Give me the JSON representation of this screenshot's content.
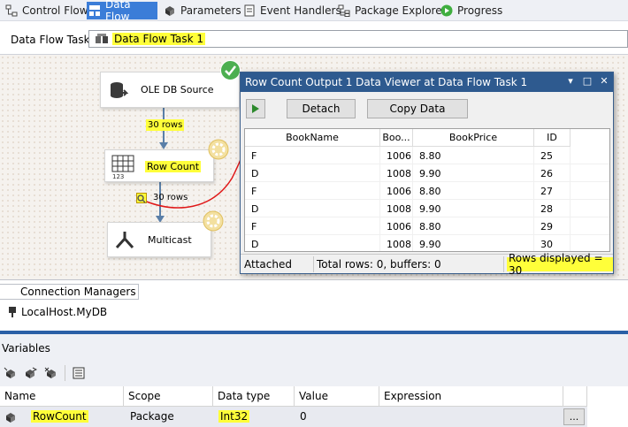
{
  "tabs": [
    {
      "label": "Control Flow",
      "icon": "control-flow-icon",
      "active": false
    },
    {
      "label": "Data Flow",
      "icon": "data-flow-icon",
      "active": true
    },
    {
      "label": "Parameters",
      "icon": "parameters-icon",
      "active": false
    },
    {
      "label": "Event Handlers",
      "icon": "event-handlers-icon",
      "active": false
    },
    {
      "label": "Package Explorer",
      "icon": "package-explorer-icon",
      "active": false
    },
    {
      "label": "Progress",
      "icon": "progress-play-icon",
      "active": false
    }
  ],
  "task": {
    "label": "Data Flow Task:",
    "value": "Data Flow Task 1"
  },
  "designer": {
    "components": [
      {
        "name": "OLE DB Source",
        "icon": "database-source-icon",
        "status": "success-check-icon"
      },
      {
        "name": "Row Count",
        "icon": "row-count-grid-icon",
        "status": "executing-gear-icon"
      },
      {
        "name": "Multicast",
        "icon": "multicast-arrows-icon",
        "status": "executing-gear-icon"
      }
    ],
    "paths": [
      {
        "label": "30 rows"
      },
      {
        "label": "30 rows"
      }
    ]
  },
  "viewer": {
    "title": "Row Count Output 1 Data Viewer at Data Flow Task 1",
    "detach_label": "Detach",
    "copy_label": "Copy Data",
    "columns": [
      "BookName",
      "Boo...",
      "BookPrice",
      "ID"
    ],
    "rows": [
      [
        "F",
        "1006",
        "8.80",
        "25"
      ],
      [
        "D",
        "1008",
        "9.90",
        "26"
      ],
      [
        "F",
        "1006",
        "8.80",
        "27"
      ],
      [
        "D",
        "1008",
        "9.90",
        "28"
      ],
      [
        "F",
        "1006",
        "8.80",
        "29"
      ],
      [
        "D",
        "1008",
        "9.90",
        "30"
      ]
    ],
    "status": {
      "attached": "Attached",
      "totals": "Total rows: 0, buffers: 0",
      "displayed": "Rows displayed = 30"
    }
  },
  "connection_managers": {
    "tab_label": "Connection Managers",
    "items": [
      {
        "label": "LocalHost.MyDB",
        "icon": "connection-plug-icon"
      }
    ]
  },
  "variables": {
    "title": "Variables",
    "toolbar_icons": [
      "add-variable-icon",
      "move-variable-icon",
      "delete-variable-icon",
      "grid-options-icon"
    ],
    "columns": [
      "Name",
      "Scope",
      "Data type",
      "Value",
      "Expression"
    ],
    "rows": [
      {
        "name": "RowCount",
        "scope": "Package",
        "type": "Int32",
        "value": "0",
        "expression": "",
        "ellipsis": "..."
      }
    ]
  },
  "colors": {
    "accent_blue": "#3b7dd8",
    "viewer_title_blue": "#2e5a8f",
    "highlight_yellow": "#ffff3a",
    "annotation_red": "#e01818",
    "success_green": "#3fae3f"
  }
}
